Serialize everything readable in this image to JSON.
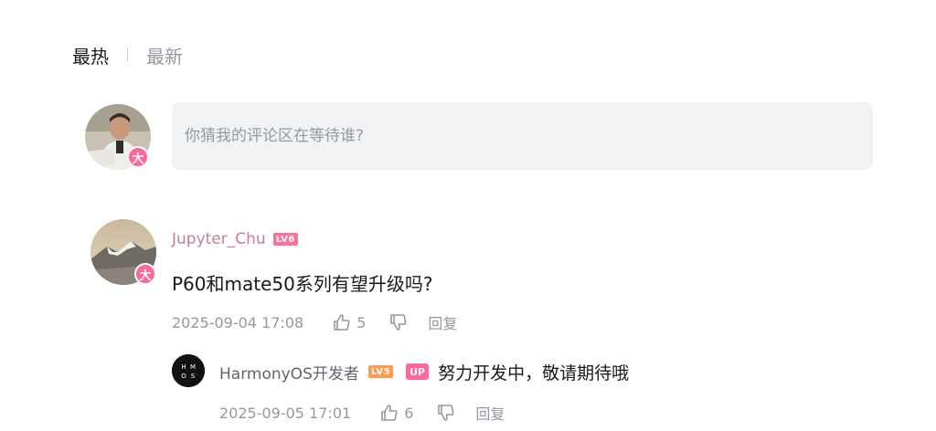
{
  "sort": {
    "hot": "最热",
    "new": "最新"
  },
  "input": {
    "placeholder": "你猜我的评论区在等待谁?"
  },
  "self_avatar": {
    "badge": "大"
  },
  "comment": {
    "author": "Jupyter_Chu",
    "level": "LV6",
    "badge": "大",
    "text": "P60和mate50系列有望升级吗?",
    "time": "2025-09-04 17:08",
    "likes": "5",
    "reply_label": "回复"
  },
  "reply": {
    "avatar_text": "H M O S",
    "author": "HarmonyOS开发者",
    "level": "LV5",
    "up_tag": "UP",
    "text": "努力开发中，敬请期待哦",
    "time": "2025-09-05 17:01",
    "likes": "6",
    "reply_label": "回复"
  },
  "colors": {
    "accent": "#ff6699",
    "username": "#c3809a",
    "muted": "#9499a0"
  }
}
